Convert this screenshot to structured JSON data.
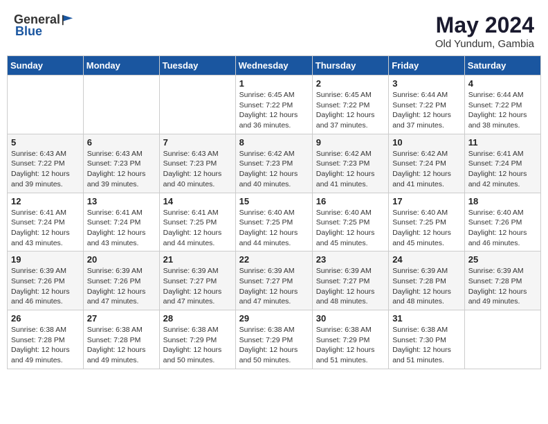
{
  "header": {
    "logo_general": "General",
    "logo_blue": "Blue",
    "month_year": "May 2024",
    "location": "Old Yundum, Gambia"
  },
  "weekdays": [
    "Sunday",
    "Monday",
    "Tuesday",
    "Wednesday",
    "Thursday",
    "Friday",
    "Saturday"
  ],
  "weeks": [
    [
      {
        "day": "",
        "info": ""
      },
      {
        "day": "",
        "info": ""
      },
      {
        "day": "",
        "info": ""
      },
      {
        "day": "1",
        "info": "Sunrise: 6:45 AM\nSunset: 7:22 PM\nDaylight: 12 hours and 36 minutes."
      },
      {
        "day": "2",
        "info": "Sunrise: 6:45 AM\nSunset: 7:22 PM\nDaylight: 12 hours and 37 minutes."
      },
      {
        "day": "3",
        "info": "Sunrise: 6:44 AM\nSunset: 7:22 PM\nDaylight: 12 hours and 37 minutes."
      },
      {
        "day": "4",
        "info": "Sunrise: 6:44 AM\nSunset: 7:22 PM\nDaylight: 12 hours and 38 minutes."
      }
    ],
    [
      {
        "day": "5",
        "info": "Sunrise: 6:43 AM\nSunset: 7:22 PM\nDaylight: 12 hours and 39 minutes."
      },
      {
        "day": "6",
        "info": "Sunrise: 6:43 AM\nSunset: 7:23 PM\nDaylight: 12 hours and 39 minutes."
      },
      {
        "day": "7",
        "info": "Sunrise: 6:43 AM\nSunset: 7:23 PM\nDaylight: 12 hours and 40 minutes."
      },
      {
        "day": "8",
        "info": "Sunrise: 6:42 AM\nSunset: 7:23 PM\nDaylight: 12 hours and 40 minutes."
      },
      {
        "day": "9",
        "info": "Sunrise: 6:42 AM\nSunset: 7:23 PM\nDaylight: 12 hours and 41 minutes."
      },
      {
        "day": "10",
        "info": "Sunrise: 6:42 AM\nSunset: 7:24 PM\nDaylight: 12 hours and 41 minutes."
      },
      {
        "day": "11",
        "info": "Sunrise: 6:41 AM\nSunset: 7:24 PM\nDaylight: 12 hours and 42 minutes."
      }
    ],
    [
      {
        "day": "12",
        "info": "Sunrise: 6:41 AM\nSunset: 7:24 PM\nDaylight: 12 hours and 43 minutes."
      },
      {
        "day": "13",
        "info": "Sunrise: 6:41 AM\nSunset: 7:24 PM\nDaylight: 12 hours and 43 minutes."
      },
      {
        "day": "14",
        "info": "Sunrise: 6:41 AM\nSunset: 7:25 PM\nDaylight: 12 hours and 44 minutes."
      },
      {
        "day": "15",
        "info": "Sunrise: 6:40 AM\nSunset: 7:25 PM\nDaylight: 12 hours and 44 minutes."
      },
      {
        "day": "16",
        "info": "Sunrise: 6:40 AM\nSunset: 7:25 PM\nDaylight: 12 hours and 45 minutes."
      },
      {
        "day": "17",
        "info": "Sunrise: 6:40 AM\nSunset: 7:25 PM\nDaylight: 12 hours and 45 minutes."
      },
      {
        "day": "18",
        "info": "Sunrise: 6:40 AM\nSunset: 7:26 PM\nDaylight: 12 hours and 46 minutes."
      }
    ],
    [
      {
        "day": "19",
        "info": "Sunrise: 6:39 AM\nSunset: 7:26 PM\nDaylight: 12 hours and 46 minutes."
      },
      {
        "day": "20",
        "info": "Sunrise: 6:39 AM\nSunset: 7:26 PM\nDaylight: 12 hours and 47 minutes."
      },
      {
        "day": "21",
        "info": "Sunrise: 6:39 AM\nSunset: 7:27 PM\nDaylight: 12 hours and 47 minutes."
      },
      {
        "day": "22",
        "info": "Sunrise: 6:39 AM\nSunset: 7:27 PM\nDaylight: 12 hours and 47 minutes."
      },
      {
        "day": "23",
        "info": "Sunrise: 6:39 AM\nSunset: 7:27 PM\nDaylight: 12 hours and 48 minutes."
      },
      {
        "day": "24",
        "info": "Sunrise: 6:39 AM\nSunset: 7:28 PM\nDaylight: 12 hours and 48 minutes."
      },
      {
        "day": "25",
        "info": "Sunrise: 6:39 AM\nSunset: 7:28 PM\nDaylight: 12 hours and 49 minutes."
      }
    ],
    [
      {
        "day": "26",
        "info": "Sunrise: 6:38 AM\nSunset: 7:28 PM\nDaylight: 12 hours and 49 minutes."
      },
      {
        "day": "27",
        "info": "Sunrise: 6:38 AM\nSunset: 7:28 PM\nDaylight: 12 hours and 49 minutes."
      },
      {
        "day": "28",
        "info": "Sunrise: 6:38 AM\nSunset: 7:29 PM\nDaylight: 12 hours and 50 minutes."
      },
      {
        "day": "29",
        "info": "Sunrise: 6:38 AM\nSunset: 7:29 PM\nDaylight: 12 hours and 50 minutes."
      },
      {
        "day": "30",
        "info": "Sunrise: 6:38 AM\nSunset: 7:29 PM\nDaylight: 12 hours and 51 minutes."
      },
      {
        "day": "31",
        "info": "Sunrise: 6:38 AM\nSunset: 7:30 PM\nDaylight: 12 hours and 51 minutes."
      },
      {
        "day": "",
        "info": ""
      }
    ]
  ]
}
